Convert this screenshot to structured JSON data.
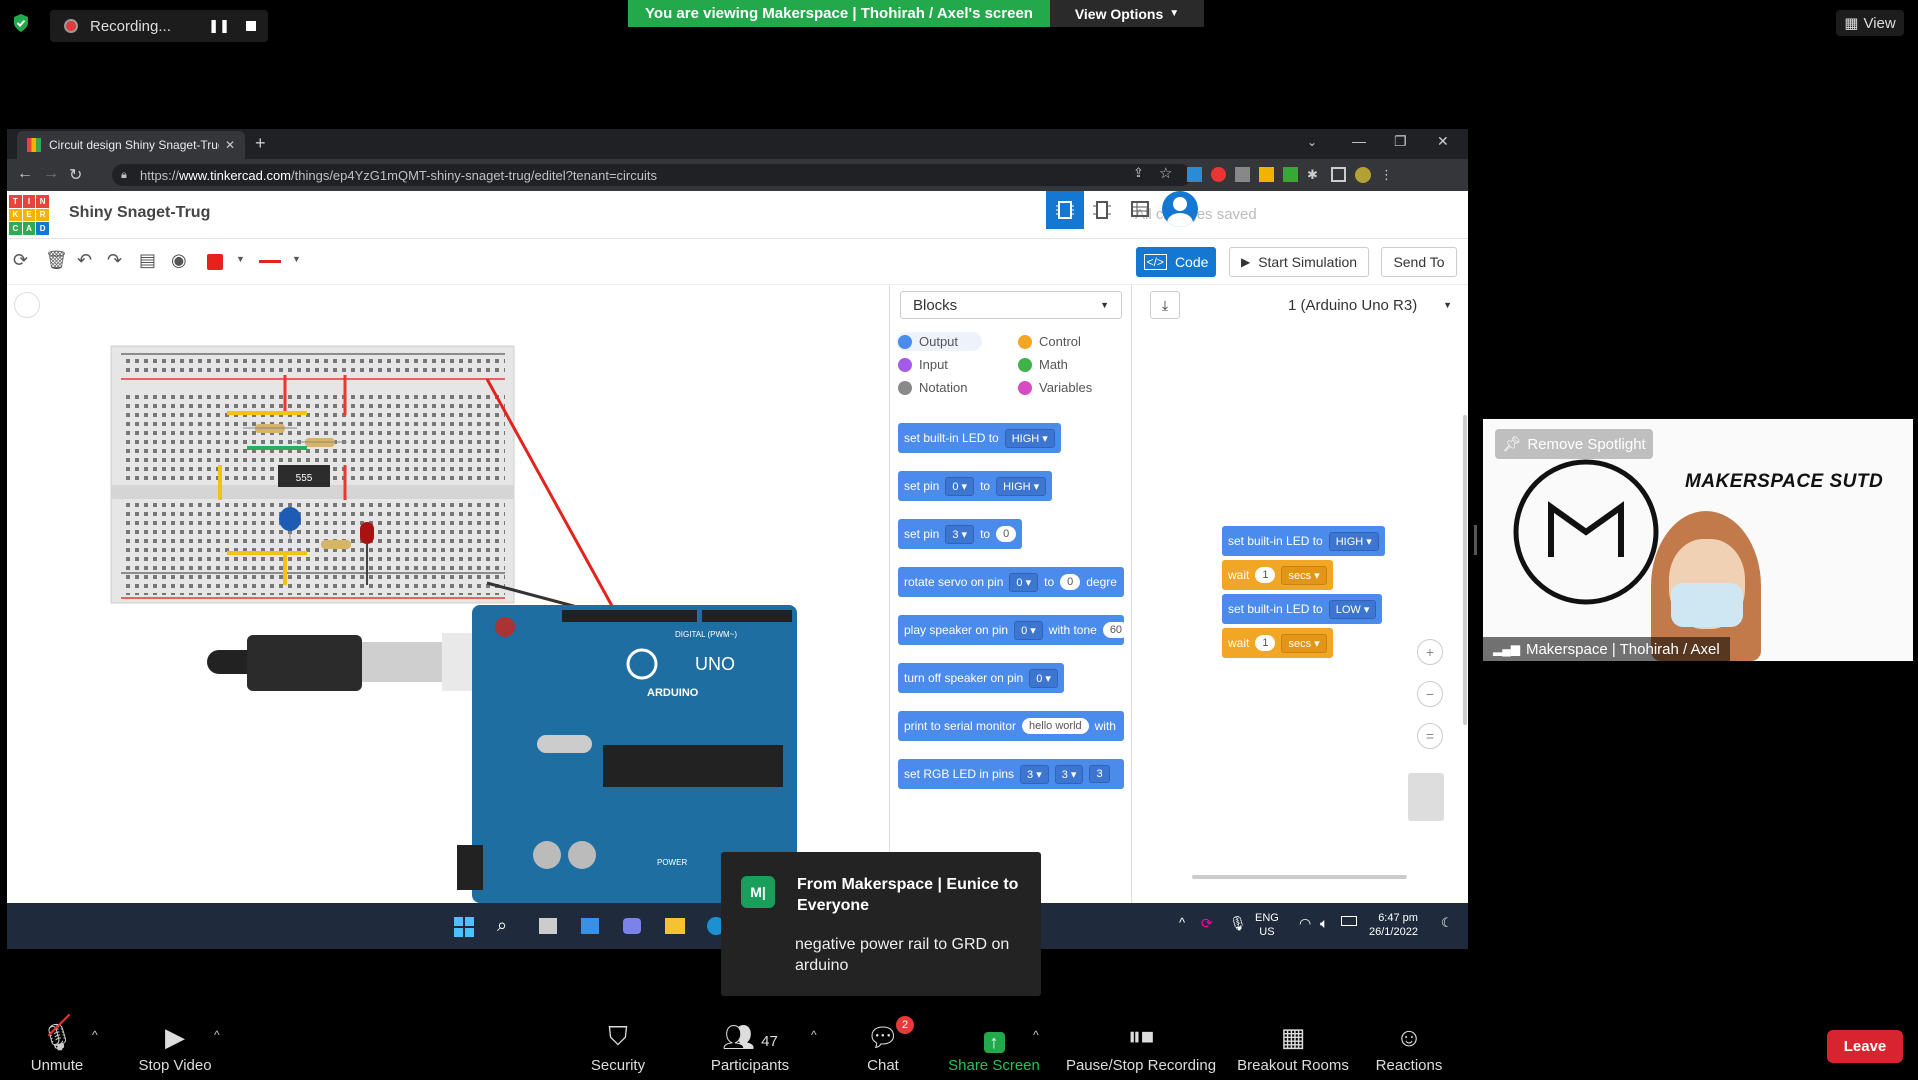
{
  "zoom": {
    "recording": {
      "label": "Recording..."
    },
    "viewing_banner": "You are viewing Makerspace | Thohirah / Axel's screen",
    "view_options": "View Options",
    "view_button": "View",
    "video": {
      "remove_spotlight": "Remove Spotlight",
      "org_name": "MAKERSPACE SUTD",
      "participant_name": "Makerspace | Thohirah / Axel"
    },
    "chat_popup": {
      "avatar": "M|",
      "from": "From Makerspace | Eunice to Everyone",
      "message": "negative power rail to GRD on arduino"
    },
    "toolbar": {
      "unmute": "Unmute",
      "stop_video": "Stop Video",
      "security": "Security",
      "participants": "Participants",
      "participants_count": "47",
      "chat": "Chat",
      "chat_badge": "2",
      "share_screen": "Share Screen",
      "pause_stop": "Pause/Stop Recording",
      "breakout": "Breakout Rooms",
      "reactions": "Reactions",
      "leave": "Leave"
    }
  },
  "browser": {
    "tab_title": "Circuit design Shiny Snaget-Trug",
    "url_prefix": "https://",
    "url_host": "www.tinkercad.com",
    "url_path": "/things/ep4YzG1mQMT-shiny-snaget-trug/editel?tenant=circuits"
  },
  "tinkercad": {
    "logo_letters": [
      "T",
      "I",
      "N",
      "K",
      "E",
      "R",
      "C",
      "A",
      "D"
    ],
    "design_title": "Shiny Snaget-Trug",
    "save_status": "All changes saved",
    "code_button": "Code",
    "start_sim": "Start Simulation",
    "send_to": "Send To",
    "blocks_select": "Blocks",
    "device_select": "1 (Arduino Uno R3)",
    "chip_label": "555",
    "arduino_label": "ARDUINO",
    "uno_label": "UNO",
    "digital_label": "DIGITAL (PWM~)",
    "power_label": "POWER",
    "categories": [
      {
        "label": "Output",
        "color": "#4b8bec"
      },
      {
        "label": "Control",
        "color": "#f2a625"
      },
      {
        "label": "Input",
        "color": "#a55bea"
      },
      {
        "label": "Math",
        "color": "#3fb24a"
      },
      {
        "label": "Notation",
        "color": "#8a8a8a"
      },
      {
        "label": "Variables",
        "color": "#d64cc4"
      }
    ],
    "palette": {
      "b1": {
        "text": "set built-in LED to",
        "d1": "HIGH"
      },
      "b2": {
        "text": "set pin",
        "d1": "0",
        "mid": "to",
        "d2": "HIGH"
      },
      "b3": {
        "text": "set pin",
        "d1": "3",
        "mid": "to",
        "v": "0"
      },
      "b4": {
        "text": "rotate servo on pin",
        "d1": "0",
        "mid": "to",
        "v": "0",
        "tail": "degre"
      },
      "b5": {
        "text": "play speaker on pin",
        "d1": "0",
        "mid": "with tone",
        "v": "60"
      },
      "b6": {
        "text": "turn off speaker on pin",
        "d1": "0"
      },
      "b7": {
        "text": "print to serial monitor",
        "v": "hello world",
        "tail": "with"
      },
      "b8": {
        "text": "set RGB LED in pins",
        "d1": "3",
        "d2": "3",
        "d3": "3"
      }
    },
    "program": {
      "s1": {
        "text": "set built-in LED to",
        "d": "HIGH"
      },
      "w1": {
        "text": "wait",
        "v": "1",
        "d": "secs"
      },
      "s2": {
        "text": "set built-in LED to",
        "d": "LOW"
      },
      "w2": {
        "text": "wait",
        "v": "1",
        "d": "secs"
      }
    }
  },
  "windows": {
    "lang": "ENG",
    "region": "US",
    "time": "6:47 pm",
    "date": "26/1/2022"
  }
}
